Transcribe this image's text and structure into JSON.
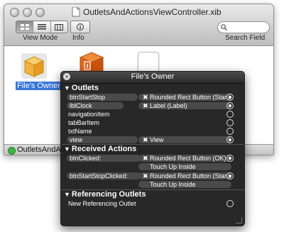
{
  "window": {
    "title": "OutletsAndActionsViewController.xib",
    "toolbar": {
      "view_mode_label": "View Mode",
      "info_label": "Info",
      "search_label": "Search Field"
    },
    "status_text": "OutletsAndActionsVi"
  },
  "document_items": [
    {
      "label": "File's Owner",
      "selected": true
    }
  ],
  "hud": {
    "title": "File's Owner",
    "outlets_header": "Outlets",
    "outlets": [
      {
        "name": "btnStartStop",
        "connected": true,
        "target": "Rounded Rect Button (Star..."
      },
      {
        "name": "lblClock",
        "connected": true,
        "target": "Label (Label)"
      },
      {
        "name": "navigationItem",
        "connected": false
      },
      {
        "name": "tabBarItem",
        "connected": false
      },
      {
        "name": "txtName",
        "connected": false
      },
      {
        "name": "view",
        "connected": true,
        "target": "View"
      }
    ],
    "received_actions_header": "Received Actions",
    "received_actions": [
      {
        "name": "btnClicked:",
        "target": "Rounded Rect Button (OK)",
        "event": "Touch Up Inside"
      },
      {
        "name": "btnStartStopClicked:",
        "target": "Rounded Rect Button (Star...",
        "event": "Touch Up Inside"
      }
    ],
    "referencing_outlets_header": "Referencing Outlets",
    "referencing_outlets": [
      {
        "name": "New Referencing Outlet"
      }
    ]
  }
}
